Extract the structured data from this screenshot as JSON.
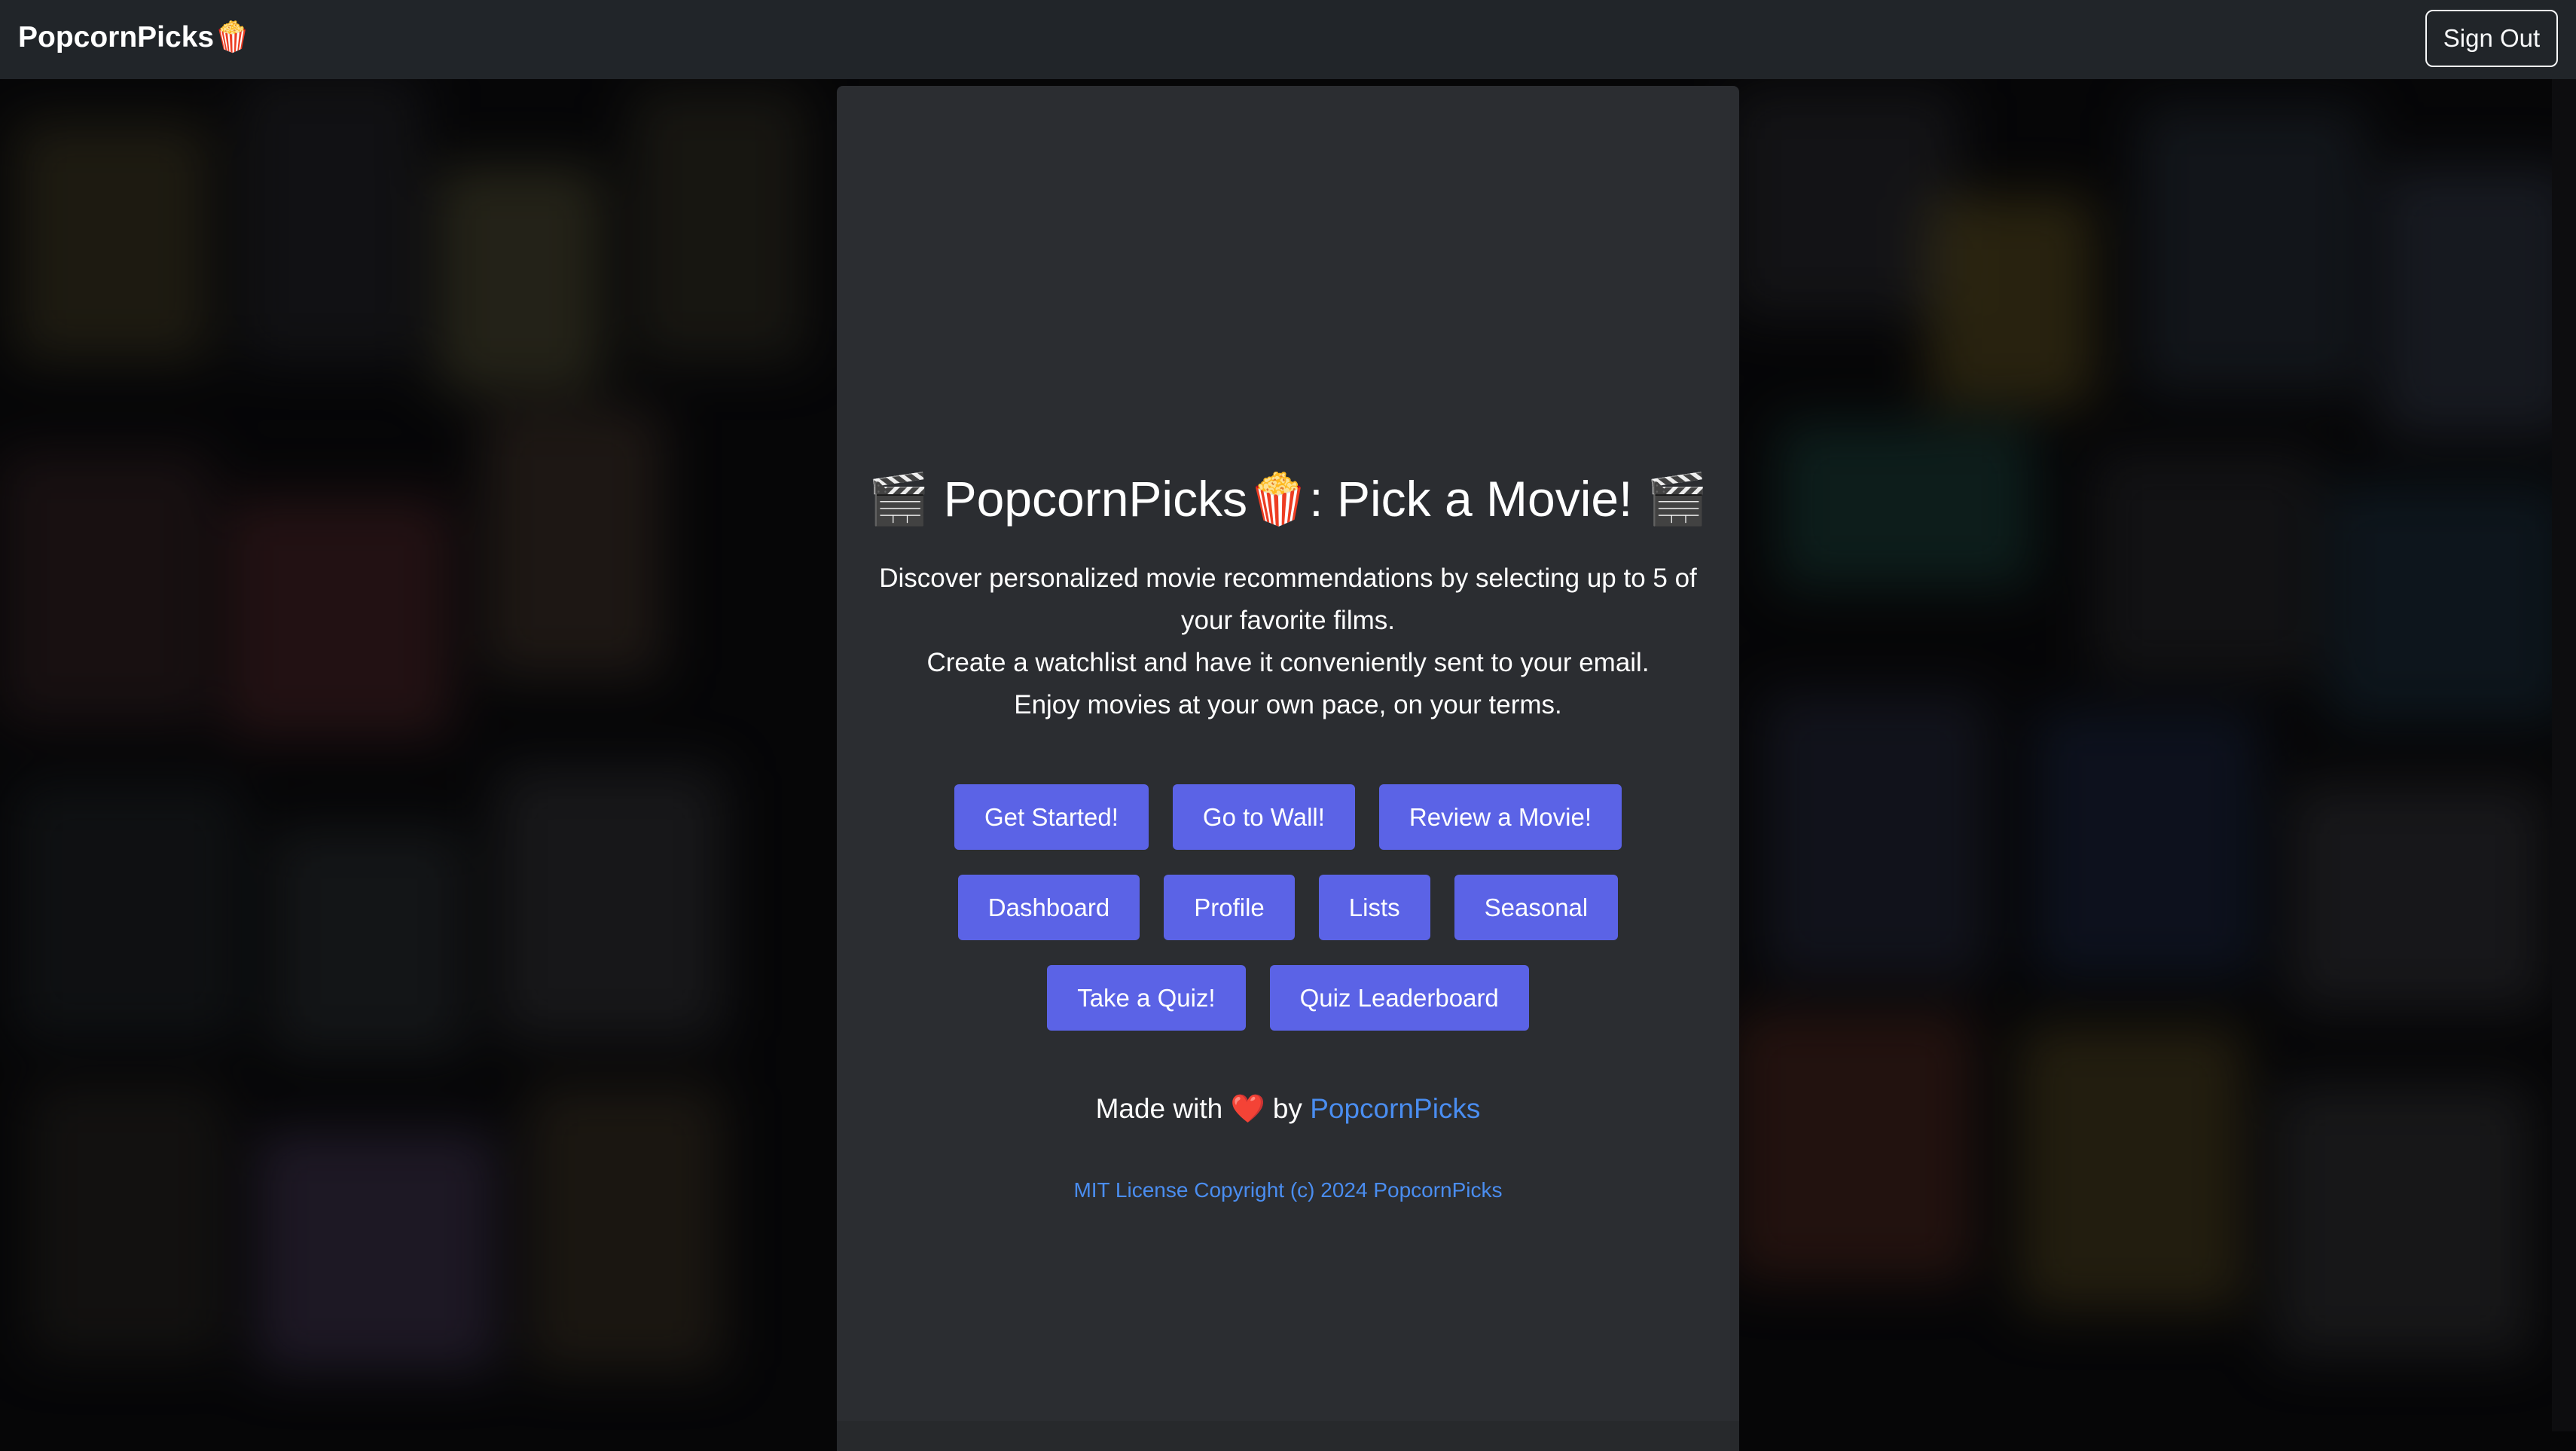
{
  "navbar": {
    "brand": "PopcornPicks🍿",
    "sign_out_label": "Sign Out"
  },
  "hero": {
    "title_emoji_left": "🎬",
    "title": "PopcornPicks🍿: Pick a Movie!",
    "title_emoji_right": "🎬",
    "description_lines": [
      "Discover personalized movie recommendations by selecting up to 5 of your favorite films.",
      "Create a watchlist and have it conveniently sent to your email.",
      "Enjoy movies at your own pace, on your terms."
    ]
  },
  "buttons": {
    "get_started": "Get Started!",
    "go_to_wall": "Go to Wall!",
    "review_movie": "Review a Movie!",
    "dashboard": "Dashboard",
    "profile": "Profile",
    "lists": "Lists",
    "seasonal": "Seasonal",
    "take_quiz": "Take a Quiz!",
    "quiz_leaderboard": "Quiz Leaderboard"
  },
  "footer": {
    "made_with": "Made with",
    "heart": "❤️",
    "by": "by",
    "link_text": "PopcornPicks",
    "license": "MIT License Copyright (c) 2024 PopcornPicks"
  },
  "colors": {
    "navbar_bg": "#212529",
    "card_bg": "#2b2d31",
    "button_bg": "#5b63e6",
    "link": "#4a8df0"
  },
  "icons": {
    "clapper": "clapperboard-icon",
    "popcorn": "popcorn-icon",
    "heart": "heart-icon"
  }
}
